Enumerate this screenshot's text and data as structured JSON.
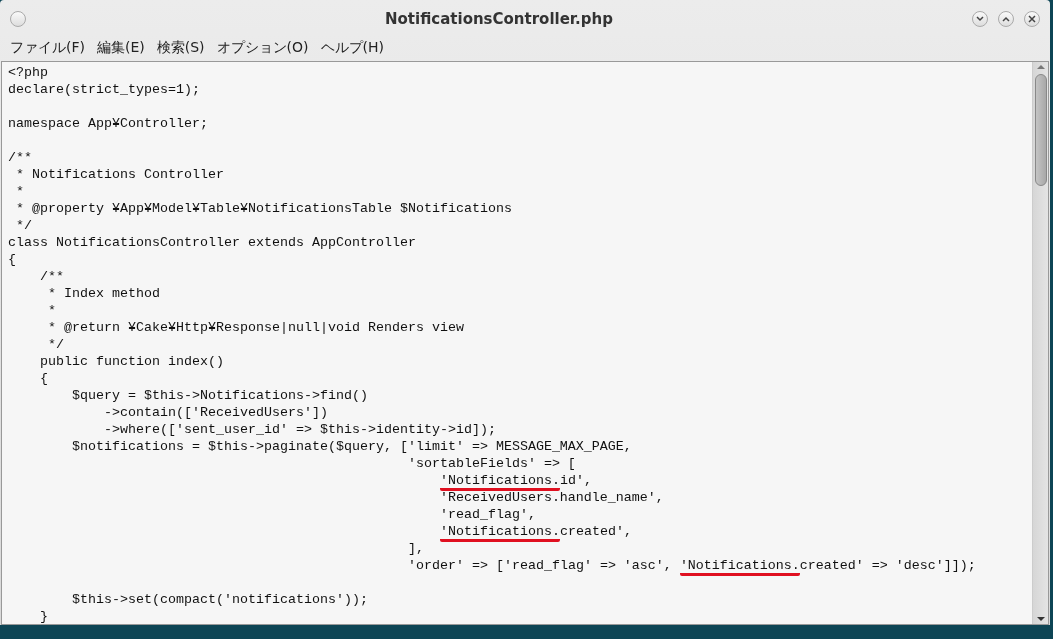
{
  "window": {
    "title": "NotificationsController.php"
  },
  "menu": [
    "ファイル(F)",
    "編集(E)",
    "検索(S)",
    "オプション(O)",
    "ヘルプ(H)"
  ],
  "editor": {
    "lines": [
      {
        "kind": "code",
        "text": "<?php"
      },
      {
        "kind": "code",
        "text": "declare(strict_types=1);"
      },
      {
        "kind": "blank"
      },
      {
        "kind": "code",
        "text": "namespace App¥Controller;"
      },
      {
        "kind": "blank"
      },
      {
        "kind": "code",
        "text": "/**"
      },
      {
        "kind": "code",
        "text": " * Notifications Controller"
      },
      {
        "kind": "code",
        "text": " *"
      },
      {
        "kind": "code",
        "text": " * @property ¥App¥Model¥Table¥NotificationsTable $Notifications"
      },
      {
        "kind": "code",
        "text": " */"
      },
      {
        "kind": "code",
        "text": "class NotificationsController extends AppController"
      },
      {
        "kind": "code",
        "text": "{"
      },
      {
        "kind": "code",
        "text": "    /**"
      },
      {
        "kind": "code",
        "text": "     * Index method"
      },
      {
        "kind": "code",
        "text": "     *"
      },
      {
        "kind": "code",
        "text": "     * @return ¥Cake¥Http¥Response|null|void Renders view"
      },
      {
        "kind": "code",
        "text": "     */"
      },
      {
        "kind": "code",
        "text": "    public function index()"
      },
      {
        "kind": "code",
        "text": "    {"
      },
      {
        "kind": "code",
        "text": "        $query = $this->Notifications->find()"
      },
      {
        "kind": "code",
        "text": "            ->contain(['ReceivedUsers'])"
      },
      {
        "kind": "code",
        "text": "            ->where(['sent_user_id' => $this->identity->id]);"
      },
      {
        "kind": "code",
        "text": "        $notifications = $this->paginate($query, ['limit' => MESSAGE_MAX_PAGE,"
      },
      {
        "kind": "code",
        "text": "                                                  'sortableFields' => ["
      },
      {
        "kind": "marked",
        "parts": [
          {
            "text": "                                                      'Notifications.",
            "underlined": true
          },
          {
            "text": "id',",
            "underlined": false
          }
        ]
      },
      {
        "kind": "code",
        "text": "                                                      'ReceivedUsers.handle_name',"
      },
      {
        "kind": "code",
        "text": "                                                      'read_flag',"
      },
      {
        "kind": "marked",
        "parts": [
          {
            "text": "                                                      'Notifications.",
            "underlined": true
          },
          {
            "text": "created',",
            "underlined": false
          }
        ]
      },
      {
        "kind": "code",
        "text": "                                                  ],"
      },
      {
        "kind": "marked",
        "parts": [
          {
            "text": "                                                  'order' => ['read_flag' => 'asc', ",
            "underlined": false
          },
          {
            "text": "'Notifications.",
            "underlined": true
          },
          {
            "text": "created' => 'desc']]);",
            "underlined": false
          }
        ]
      },
      {
        "kind": "blank"
      },
      {
        "kind": "code",
        "text": "        $this->set(compact('notifications'));"
      },
      {
        "kind": "code",
        "text": "    }"
      }
    ]
  }
}
